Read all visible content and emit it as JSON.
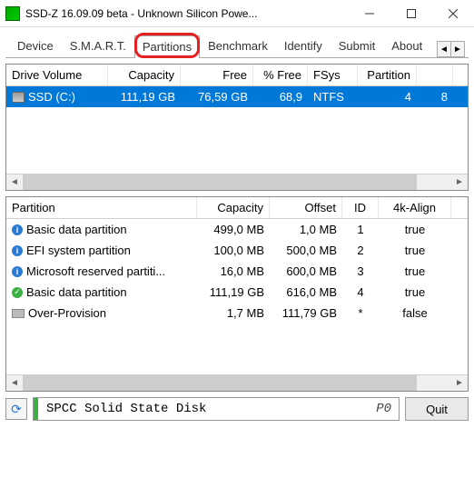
{
  "window": {
    "title": "SSD-Z 16.09.09 beta - Unknown Silicon Powe..."
  },
  "tabs": [
    "Device",
    "S.M.A.R.T.",
    "Partitions",
    "Benchmark",
    "Identify",
    "Submit",
    "About"
  ],
  "active_tab_index": 2,
  "top_table": {
    "headers": [
      "Drive Volume",
      "Capacity",
      "Free",
      "% Free",
      "FSys",
      "Partition",
      ""
    ],
    "rows": [
      {
        "volume": "SSD (C:)",
        "capacity": "111,19 GB",
        "free": "76,59 GB",
        "pct_free": "68,9",
        "fsys": "NTFS",
        "partition": "4",
        "extra": "8",
        "selected": true
      }
    ]
  },
  "bottom_table": {
    "headers": [
      "Partition",
      "Capacity",
      "Offset",
      "ID",
      "4k-Align"
    ],
    "rows": [
      {
        "icon": "info",
        "name": "Basic data partition",
        "capacity": "499,0 MB",
        "offset": "1,0 MB",
        "id": "1",
        "align": "true"
      },
      {
        "icon": "info",
        "name": "EFI system partition",
        "capacity": "100,0 MB",
        "offset": "500,0 MB",
        "id": "2",
        "align": "true"
      },
      {
        "icon": "info",
        "name": "Microsoft reserved partiti...",
        "capacity": "16,0 MB",
        "offset": "600,0 MB",
        "id": "3",
        "align": "true"
      },
      {
        "icon": "check",
        "name": "Basic data partition",
        "capacity": "111,19 GB",
        "offset": "616,0 MB",
        "id": "4",
        "align": "true"
      },
      {
        "icon": "prov",
        "name": "Over-Provision",
        "capacity": "1,7 MB",
        "offset": "111,79 GB",
        "id": "*",
        "align": "false"
      }
    ]
  },
  "footer": {
    "device_name": "SPCC Solid State Disk",
    "device_code": "P0",
    "quit_label": "Quit"
  }
}
